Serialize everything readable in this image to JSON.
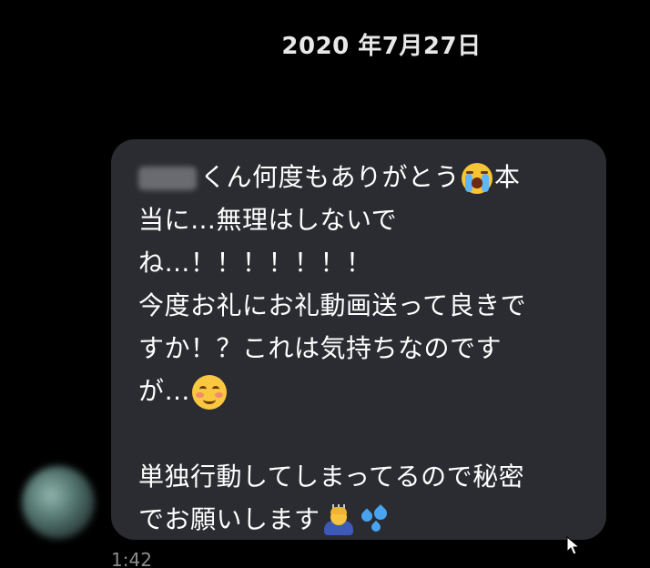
{
  "conversation": {
    "date": "2020 年7月27日",
    "message": {
      "lines": [
        "くん何度もありがとう",
        "本",
        "当に…無理はしないで",
        "ね…！！！！！！！",
        "今度お礼にお礼動画送って良きで",
        "すか！？これは気持ちなのです",
        "が…",
        "単独行動してしまってるので秘密",
        "でお願いします"
      ],
      "emoji": [
        "loudly-crying-face",
        "smiling-face",
        "person-bowing",
        "sweat-droplets"
      ],
      "timestamp": "1:42"
    }
  },
  "colors": {
    "background": "#000000",
    "bubble": "#2b2c31",
    "text": "#ffffff",
    "timestamp": "#8c8c8c"
  }
}
